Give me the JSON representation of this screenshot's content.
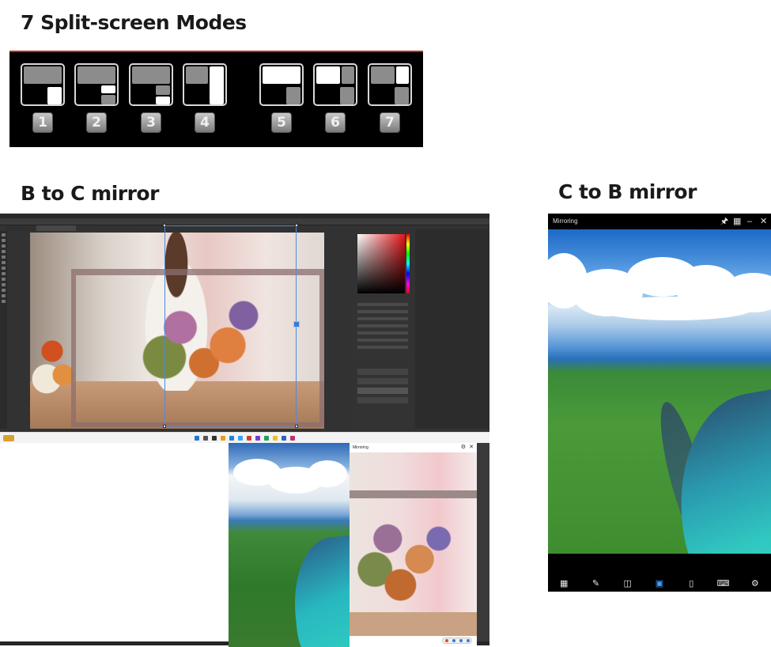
{
  "headings": {
    "modes": "7 Split-screen Modes",
    "b_to_c": "B to C mirror",
    "c_to_b": "C to B mirror"
  },
  "modes": [
    {
      "number": "1"
    },
    {
      "number": "2"
    },
    {
      "number": "3"
    },
    {
      "number": "4"
    },
    {
      "number": "5"
    },
    {
      "number": "6"
    },
    {
      "number": "7"
    }
  ],
  "colors": {
    "panel_bg": "#000000",
    "panel_accent": "#b5292a",
    "mode_grey": "#8c8c8c",
    "mode_white": "#ffffff",
    "selection_blue": "#4c8ae0",
    "active_toolbar": "#3fa0ff"
  },
  "mirror_window": {
    "title": "Mirroring",
    "controls": [
      "pin-icon",
      "grid-icon",
      "minimize-icon",
      "close-icon"
    ],
    "toolbar_icons": [
      "apps-icon",
      "annotate-icon",
      "split-screen-icon",
      "mirror-icon",
      "phone-icon",
      "keyboard-icon",
      "settings-icon"
    ]
  },
  "split_view": {
    "title": "Mirroring"
  }
}
